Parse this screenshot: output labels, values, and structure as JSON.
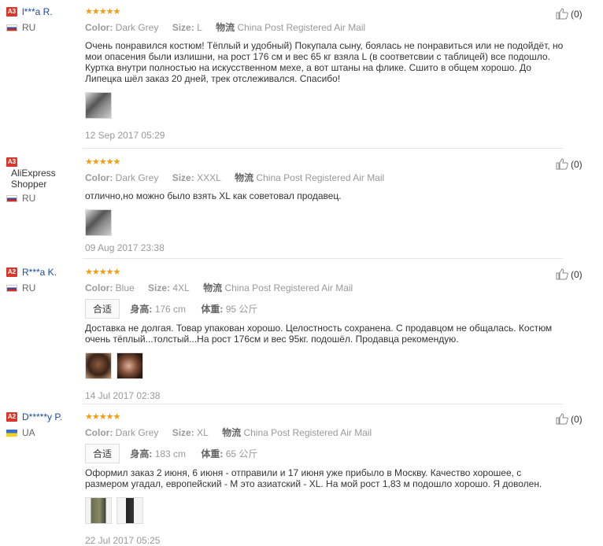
{
  "reviews": [
    {
      "badge": "A3",
      "name": "l***a R.",
      "country": "RU",
      "flag": "ru",
      "stars": "★★★★★",
      "color_label": "Color:",
      "color": "Dark Grey",
      "size_label": "Size:",
      "size": "L",
      "ship_label": "物流",
      "ship": "China Post Registered Air Mail",
      "text": "Очень понравился костюм! Тёплый и удобный) Покупала сыну, боялась не понравиться или не подойдёт, но мои опасения были излишни, на рост 176 см и вес 65 кг взяла L (в соответсвии с таблицей) все подошло. Куртка внутри полностью на искусственном мехе, а вот штаны на флике. Сшито в общем хорошо. До Липецка шёл заказ 20 дней, трек отслеживался. Спасибо!",
      "date": "12 Sep 2017 05:29",
      "likes": "(0)"
    },
    {
      "badge": "A3",
      "name": "AliExpress Shopper",
      "country": "RU",
      "flag": "ru",
      "stars": "★★★★★",
      "color_label": "Color:",
      "color": "Dark Grey",
      "size_label": "Size:",
      "size": "XXXL",
      "ship_label": "物流",
      "ship": "China Post Registered Air Mail",
      "text": "отлично,но можно было взять XL как советовал продавец.",
      "date": "09 Aug 2017 23:38",
      "likes": "(0)"
    },
    {
      "badge": "A2",
      "name": "R***a K.",
      "country": "RU",
      "flag": "ru",
      "stars": "★★★★★",
      "color_label": "Color:",
      "color": "Blue",
      "size_label": "Size:",
      "size": "4XL",
      "ship_label": "物流",
      "ship": "China Post Registered Air Mail",
      "fit_tag": "合适",
      "height_label": "身高:",
      "height": "176 cm",
      "weight_label": "体重:",
      "weight": "95 公斤",
      "text": "Доставка не долгая. Товар упакован хорошо. Целостность сохранена. С продавцом не общалась. Костюм очень тёплый...толстый...На рост 176см и вес 95кг. подошёл. Продавца рекомендую.",
      "date": "14 Jul 2017 02:38",
      "likes": "(0)"
    },
    {
      "badge": "A2",
      "name": "D*****y P.",
      "country": "UA",
      "flag": "ua",
      "stars": "★★★★★",
      "color_label": "Color:",
      "color": "Dark Grey",
      "size_label": "Size:",
      "size": "XL",
      "ship_label": "物流",
      "ship": "China Post Registered Air Mail",
      "fit_tag": "合适",
      "height_label": "身高:",
      "height": "183 cm",
      "weight_label": "体重:",
      "weight": "65 公斤",
      "text": "Оформил заказ 2 июня, 6 июня - отправили и 17 июня уже прибыло в Москву. Качество хорошее, с размером угадал, европейский - М это азиатский - XL. На мой рост 1,83 м подошло хорошо. Я доволен.",
      "date": "22 Jul 2017 05:25",
      "likes": "(0)"
    }
  ]
}
